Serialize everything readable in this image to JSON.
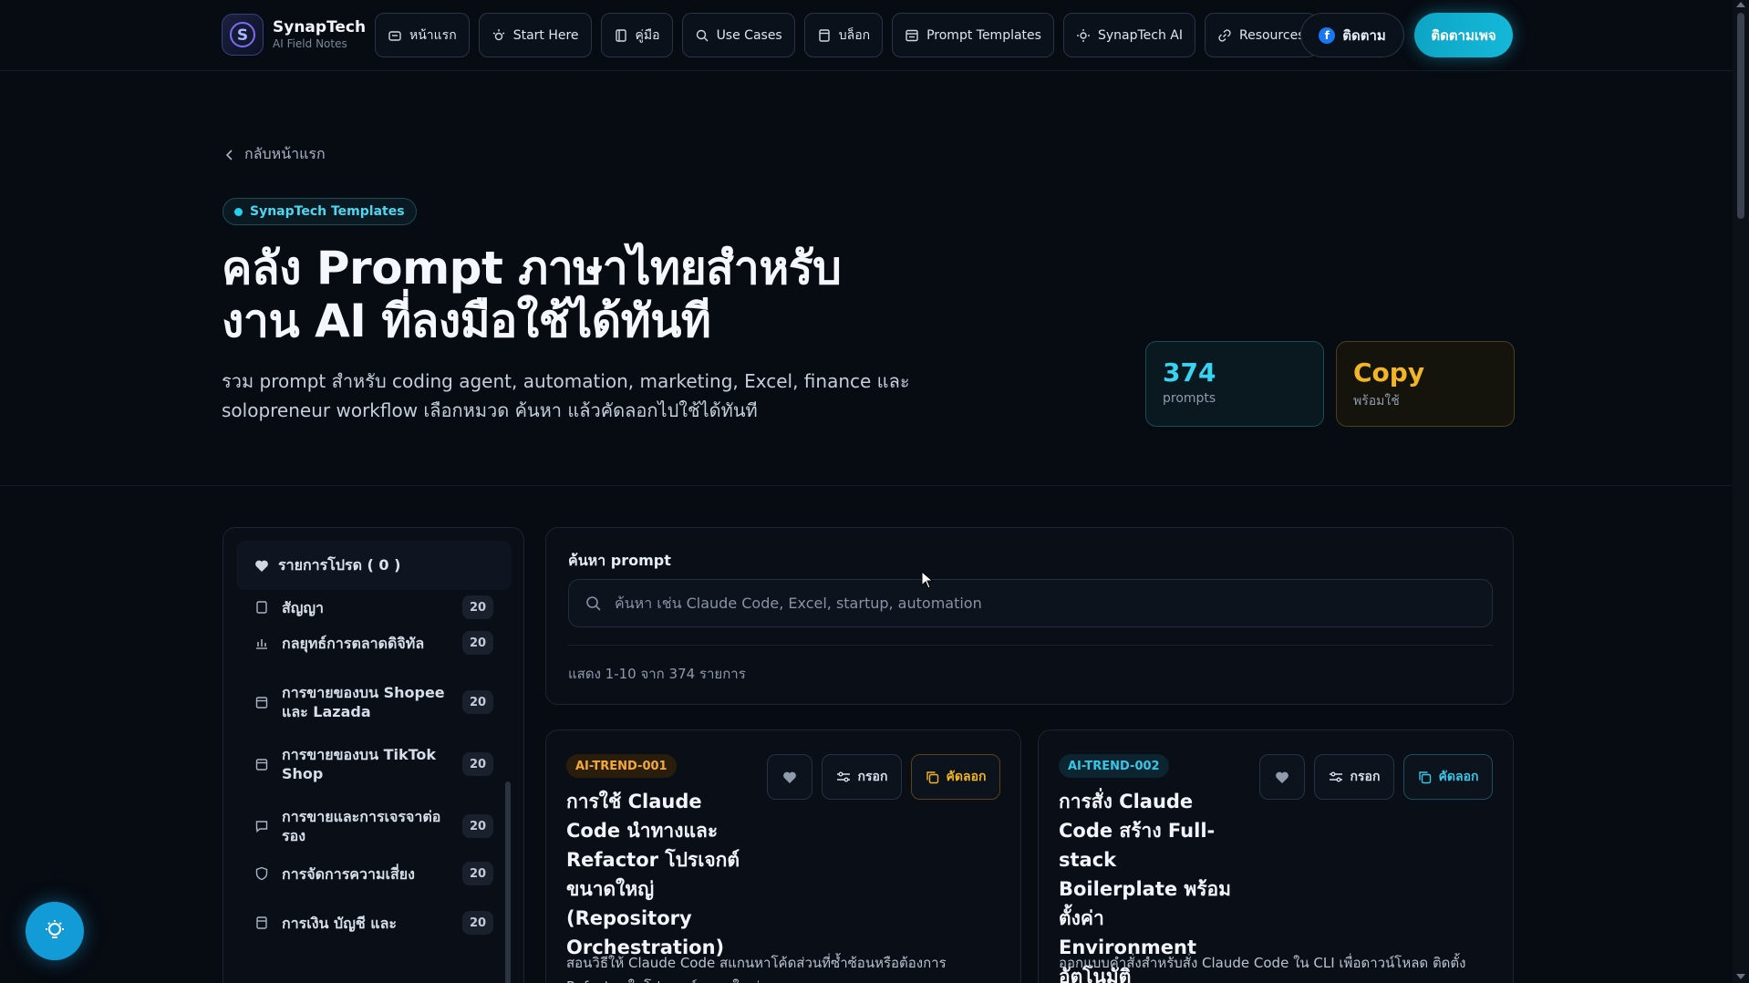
{
  "brand": {
    "name": "SynapTech",
    "subtitle": "AI Field Notes",
    "logo_letter": "S"
  },
  "nav": {
    "items": [
      {
        "label": "หน้าแรก",
        "icon": "home-icon"
      },
      {
        "label": "Start Here",
        "icon": "spark-icon"
      },
      {
        "label": "คู่มือ",
        "icon": "book-icon"
      },
      {
        "label": "Use Cases",
        "icon": "search-icon"
      },
      {
        "label": "บล็อก",
        "icon": "document-icon"
      },
      {
        "label": "Prompt Templates",
        "icon": "template-icon"
      },
      {
        "label": "SynapTech AI",
        "icon": "sun-icon"
      },
      {
        "label": "Resources",
        "icon": "link-icon"
      }
    ],
    "follow_label": "ติดตาม",
    "follow_page_label": "ติดตามเพจ"
  },
  "hero": {
    "back_label": "กลับหน้าแรก",
    "badge": "SynapTech Templates",
    "title_line1": "คลัง Prompt ภาษาไทยสำหรับ",
    "title_line2": "งาน AI ที่ลงมือใช้ได้ทันที",
    "description": "รวม prompt สำหรับ coding agent, automation, marketing, Excel, finance และ solopreneur workflow เลือกหมวด ค้นหา แล้วคัดลอกไปใช้ได้ทันที",
    "stats": [
      {
        "value": "374",
        "label": "prompts"
      },
      {
        "value": "Copy",
        "label": "พร้อมใช้"
      }
    ]
  },
  "sidebar": {
    "favorites_label": "รายการโปรด ( 0 )",
    "categories": [
      {
        "label": "สัญญา",
        "count": "20",
        "icon": "doc-icon"
      },
      {
        "label": "กลยุทธ์การตลาดดิจิทัล",
        "count": "20",
        "icon": "chart-icon"
      },
      {
        "label": "การขายของบน Shopee และ Lazada",
        "count": "20",
        "icon": "store-icon"
      },
      {
        "label": "การขายของบน TikTok Shop",
        "count": "20",
        "icon": "store-icon"
      },
      {
        "label": "การขายและการเจรจาต่อรอง",
        "count": "20",
        "icon": "chat-icon"
      },
      {
        "label": "การจัดการความเสี่ยง",
        "count": "20",
        "icon": "shield-icon"
      },
      {
        "label": "การเงิน บัญชี และ",
        "count": "20",
        "icon": "calc-icon"
      }
    ]
  },
  "search": {
    "title": "ค้นหา prompt",
    "placeholder": "ค้นหา เช่น Claude Code, Excel, startup, automation",
    "value": "",
    "result_text": "แสดง 1-10 จาก 374 รายการ"
  },
  "cards": [
    {
      "tag": "AI-TREND-001",
      "title": "การใช้ Claude Code นำทางและ Refactor โปรเจกต์ขนาดใหญ่ (Repository Orchestration)",
      "fill_label": "กรอก",
      "copy_label": "คัดลอก",
      "description": "สอนวิธีให้ Claude Code สแกนหาโค้ดส่วนที่ซ้ำซ้อนหรือต้องการ Refactor ในโปรเจกต์ขนาดใหญ่"
    },
    {
      "tag": "AI-TREND-002",
      "title": "การสั่ง Claude Code สร้าง Full-stack Boilerplate พร้อมตั้งค่า Environment อัตโนมัติ",
      "fill_label": "กรอก",
      "copy_label": "คัดลอก",
      "description": "ออกแบบคำสั่งสำหรับสั่ง Claude Code ใน CLI เพื่อดาวน์โหลด ติดตั้ง"
    }
  ],
  "colors": {
    "accent": "#14b8d9",
    "amber": "#f2b526",
    "background": "#070b12"
  }
}
